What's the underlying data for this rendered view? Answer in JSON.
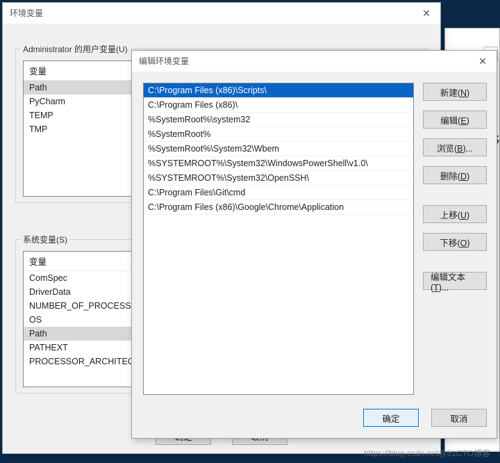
{
  "env_window": {
    "title": "环境变量",
    "user_group_label": "Administrator 的用户变量(U)",
    "sys_group_label": "系统变量(S)",
    "var_header": "变量",
    "user_vars": [
      "Path",
      "PyCharm",
      "TEMP",
      "TMP"
    ],
    "user_selected_index": 0,
    "sys_vars": [
      "ComSpec",
      "DriverData",
      "NUMBER_OF_PROCESSORS",
      "OS",
      "Path",
      "PATHEXT",
      "PROCESSOR_ARCHITECT..."
    ],
    "sys_selected_index": 4,
    "ok_label": "确定",
    "cancel_label": "取消"
  },
  "edit_window": {
    "title": "编辑环境变量",
    "paths": [
      "C:\\Program Files (x86)\\Scripts\\",
      "C:\\Program Files (x86)\\",
      "%SystemRoot%\\system32",
      "%SystemRoot%",
      "%SystemRoot%\\System32\\Wbem",
      "%SYSTEMROOT%\\System32\\WindowsPowerShell\\v1.0\\",
      "%SYSTEMROOT%\\System32\\OpenSSH\\",
      "C:\\Program Files\\Git\\cmd",
      "C:\\Program Files (x86)\\Google\\Chrome\\Application"
    ],
    "selected_index": 0,
    "buttons": {
      "new": "新建(N)",
      "edit": "编辑(E)",
      "browse": "浏览(B)...",
      "delete": "删除(D)",
      "up": "上移(U)",
      "down": "下移(O)",
      "edit_text": "编辑文本(T)..."
    },
    "ok_label": "确定",
    "cancel_label": "取消"
  },
  "watermark": "https://blog.csdn.net@51CTO博客"
}
